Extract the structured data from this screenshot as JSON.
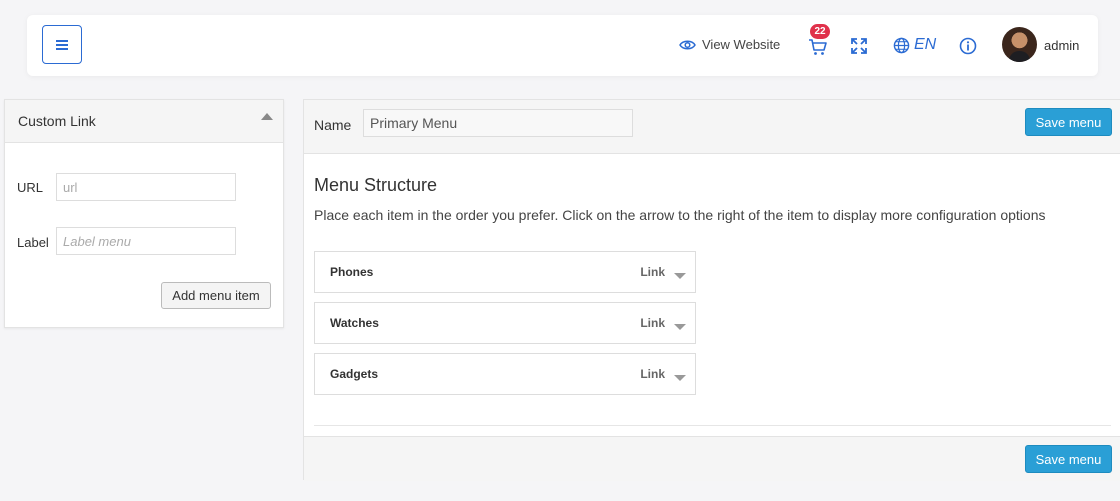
{
  "header": {
    "view_website_label": "View Website",
    "cart_count": "22",
    "language": "EN",
    "username": "admin",
    "icons": [
      "menu-icon",
      "eye-icon",
      "cart-icon",
      "expand-icon",
      "globe-icon",
      "info-icon"
    ],
    "accent_color": "#2b6bd3",
    "badge_color": "#e0314b"
  },
  "custom_link": {
    "title": "Custom Link",
    "url_label": "URL",
    "url_placeholder": "url",
    "label_label": "Label",
    "label_placeholder": "Label menu",
    "add_button": "Add menu item"
  },
  "menu": {
    "name_label": "Name",
    "name_value": "Primary Menu",
    "save_label": "Save menu",
    "structure_title": "Menu Structure",
    "structure_desc": "Place each item in the order you prefer. Click on the arrow to the right of the item to display more configuration options",
    "items": [
      {
        "title": "Phones",
        "type": "Link"
      },
      {
        "title": "Watches",
        "type": "Link"
      },
      {
        "title": "Gadgets",
        "type": "Link"
      }
    ],
    "save_color": "#2a9fd6"
  }
}
